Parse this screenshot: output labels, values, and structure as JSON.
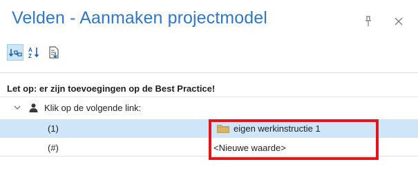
{
  "panel": {
    "title": "Velden - Aanmaken projectmodel"
  },
  "toolbar": {
    "buttons": [
      {
        "name": "categorized-icon",
        "active": true
      },
      {
        "name": "sort-alphabetical-icon",
        "active": false
      },
      {
        "name": "property-pages-icon",
        "active": false
      }
    ]
  },
  "grid": {
    "notice": "Let op: er zijn toevoegingen op de Best Practice!",
    "group_label": "Klik op de volgende link:",
    "rows": [
      {
        "key": "(1)",
        "value": "eigen werkinstructie 1"
      },
      {
        "key": "(#)",
        "value": "<Nieuwe waarde>"
      }
    ]
  },
  "colors": {
    "title": "#2f77c8",
    "selection": "#cfe5f8",
    "highlight_border": "#e4141b",
    "folder": "#d9b36a"
  }
}
